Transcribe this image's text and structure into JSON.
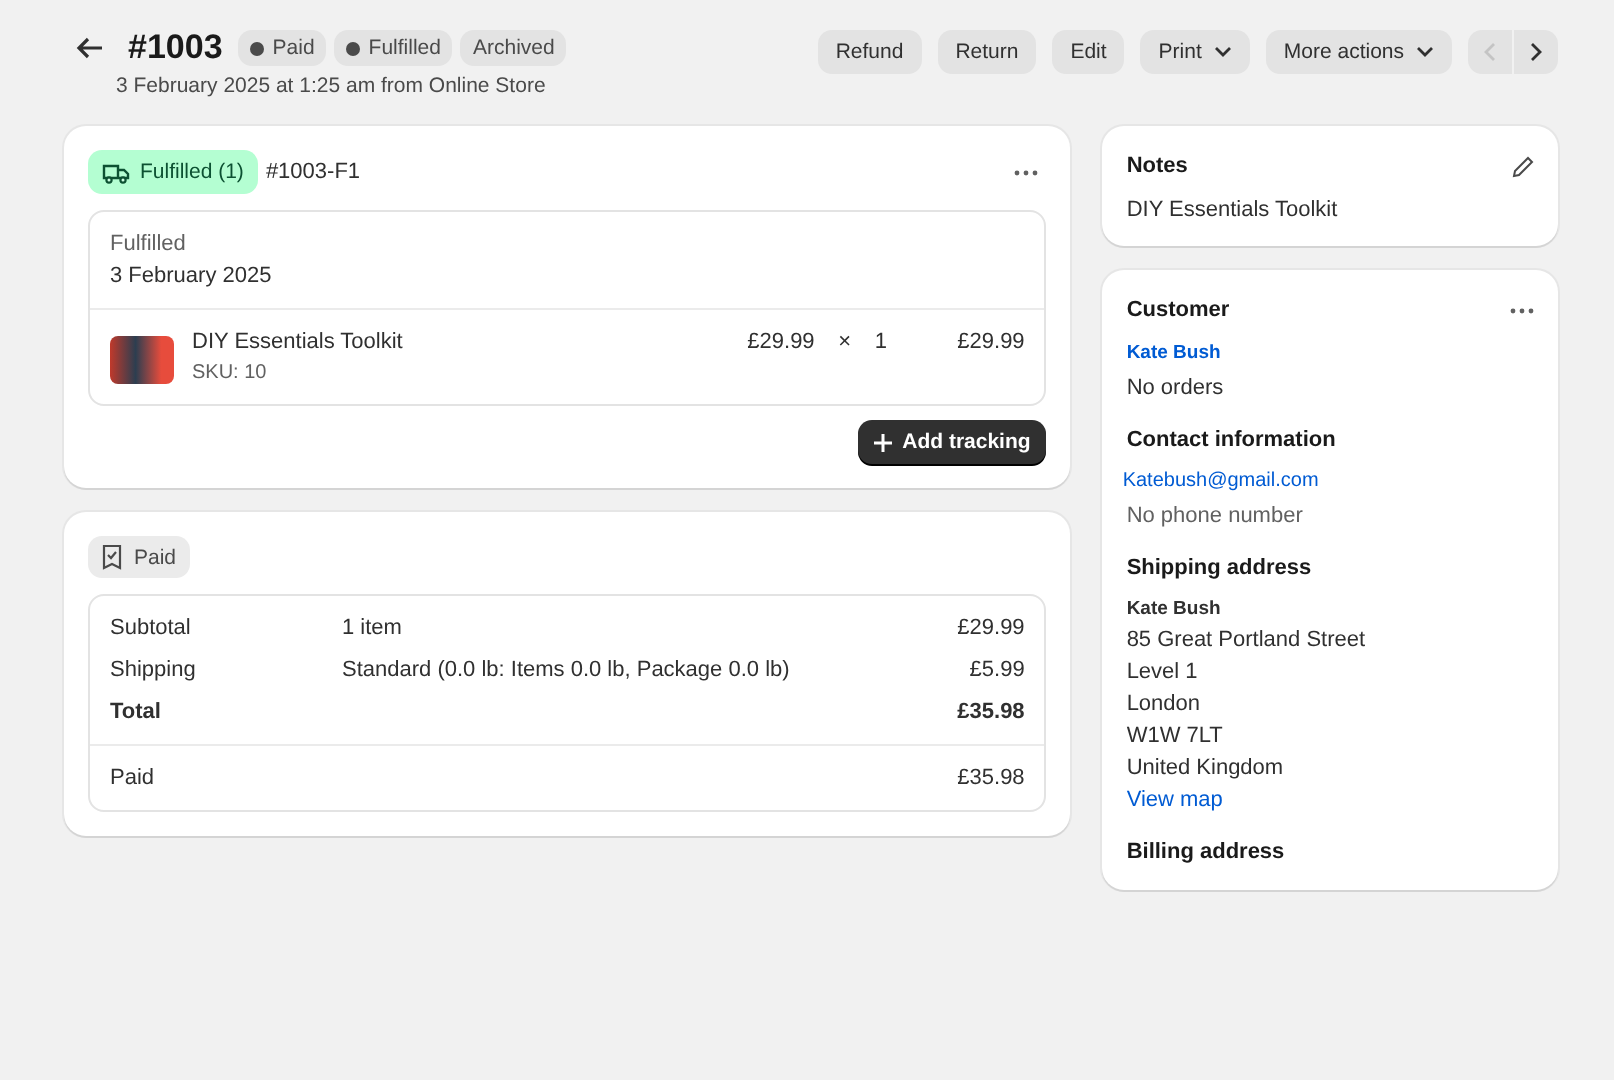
{
  "header": {
    "title": "#1003",
    "badges": [
      {
        "label": "Paid",
        "dot": true
      },
      {
        "label": "Fulfilled",
        "dot": true
      },
      {
        "label": "Archived",
        "dot": false
      }
    ],
    "subtitle": "3 February 2025 at 1:25 am from Online Store"
  },
  "actions": [
    {
      "label": "Refund",
      "dropdown": false
    },
    {
      "label": "Return",
      "dropdown": false
    },
    {
      "label": "Edit",
      "dropdown": false
    },
    {
      "label": "Print",
      "dropdown": true
    },
    {
      "label": "More actions",
      "dropdown": true
    }
  ],
  "pager": {
    "previous_disabled": true,
    "next_disabled": false
  },
  "fulfillment": {
    "status": "Fulfilled (1)",
    "id": "#1003-F1",
    "state_label": "Fulfilled",
    "date": "3 February 2025",
    "item": {
      "name": "DIY Essentials Toolkit",
      "sku": "SKU: 10",
      "price": "£29.99",
      "times": "×",
      "quantity": "1",
      "total": "£29.99"
    },
    "button": "Add tracking"
  },
  "payment": {
    "status": "Paid",
    "rows": [
      {
        "label": "Subtotal",
        "detail": "1 item",
        "amount": "£29.99",
        "bold": false
      },
      {
        "label": "Shipping",
        "detail": "Standard (0.0 lb: Items 0.0 lb, Package 0.0 lb)",
        "amount": "£5.99",
        "bold": false
      },
      {
        "label": "Total",
        "amount": "£35.98",
        "bold": true
      }
    ],
    "paid": {
      "label": "Paid",
      "amount": "£35.98"
    }
  },
  "notes": {
    "title": "Notes",
    "text": "DIY Essentials Toolkit"
  },
  "customer": {
    "title": "Customer",
    "name": "Kate Bush",
    "orders": "No orders",
    "contact_title": "Contact information",
    "email": "Katebush@gmail.com",
    "phone": "No phone number",
    "shipping_title": "Shipping address",
    "address_name": "Kate Bush",
    "address_lines": [
      "85 Great Portland Street",
      "Level 1",
      "London",
      "W1W 7LT",
      "United Kingdom"
    ],
    "map_link": "View map",
    "billing_title": "Billing address"
  }
}
